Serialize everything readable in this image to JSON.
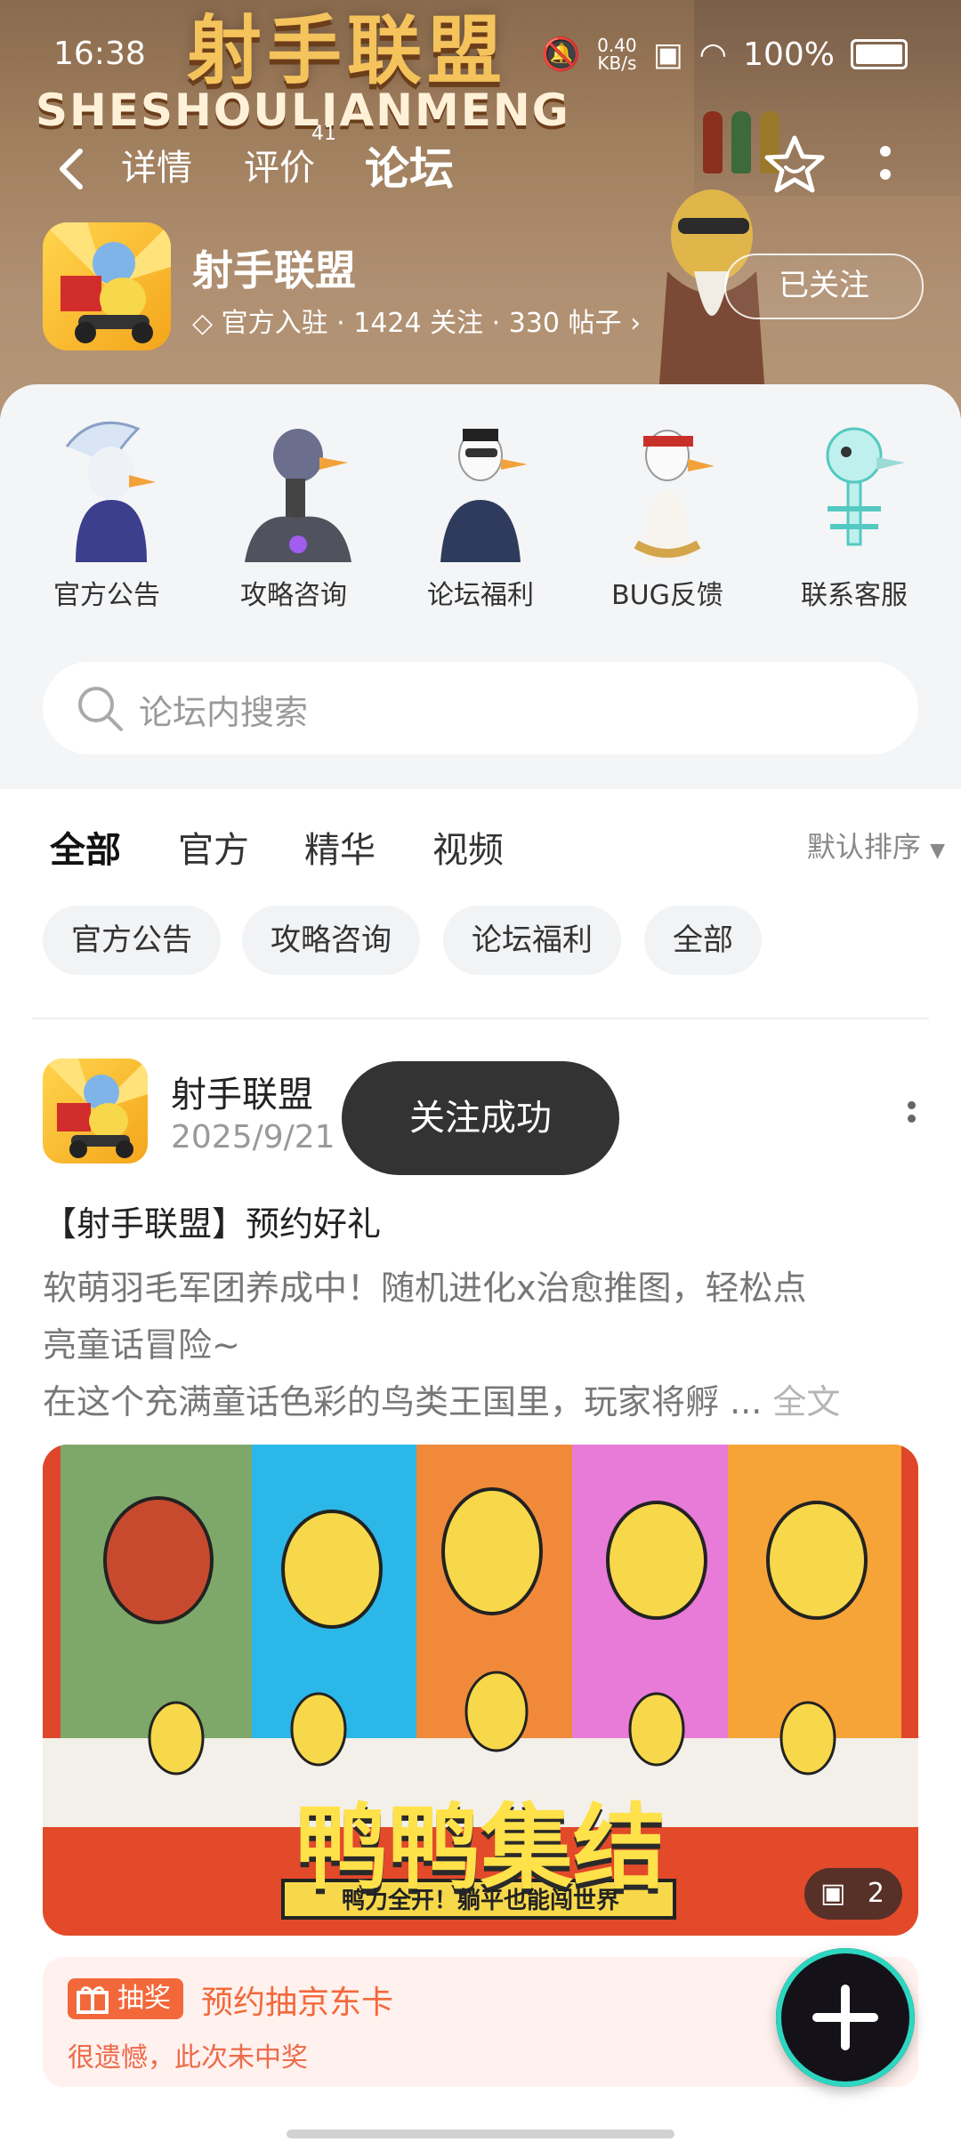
{
  "status_bar": {
    "time": "16:38",
    "net_speed_value": "0.40",
    "net_speed_unit": "KB/s",
    "battery": "100%"
  },
  "banner": {
    "title": "射手联盟",
    "subtitle": "SHESHOULIANMENG"
  },
  "nav": {
    "tabs": [
      "详情",
      "评价",
      "论坛"
    ],
    "review_count": "41",
    "active_tab": "论坛"
  },
  "game": {
    "name": "射手联盟",
    "meta": "官方入驻 · 1424 关注 · 330 帖子",
    "follow_label": "已关注"
  },
  "categories": [
    {
      "label": "官方公告",
      "icon": "blue-hair-goose-icon"
    },
    {
      "label": "攻略咨询",
      "icon": "robot-goose-icon"
    },
    {
      "label": "论坛福利",
      "icon": "headset-goose-icon"
    },
    {
      "label": "BUG反馈",
      "icon": "headband-goose-icon"
    },
    {
      "label": "联系客服",
      "icon": "skeleton-goose-icon"
    }
  ],
  "search": {
    "placeholder": "论坛内搜索"
  },
  "feed_tabs": [
    "全部",
    "官方",
    "精华",
    "视频"
  ],
  "sort_label": "默认排序",
  "filter_chips": [
    "官方公告",
    "攻略咨询",
    "论坛福利",
    "全部"
  ],
  "post": {
    "author": "射手联盟",
    "date": "2025/9/21",
    "title": "【射手联盟】预约好礼",
    "body_line1": "软萌羽毛军团养成中！随机进化x治愈推图，轻松点",
    "body_line2": "亮童话冒险~",
    "body_line3": "在这个充满童话色彩的鸟类王国里，玩家将孵 ...",
    "full_text_label": "全文",
    "image_title": "鸭鸭集结",
    "image_subtitle": "鸭力全开！躺平也能闯世界",
    "image_count": "2"
  },
  "lottery": {
    "tag": "抽奖",
    "title": "预约抽京东卡",
    "result": "很遗憾，此次未中奖"
  },
  "toast": "关注成功",
  "colors": {
    "accent": "#1cc9a6",
    "lottery": "#f3683a",
    "toast_bg": "#333333"
  }
}
